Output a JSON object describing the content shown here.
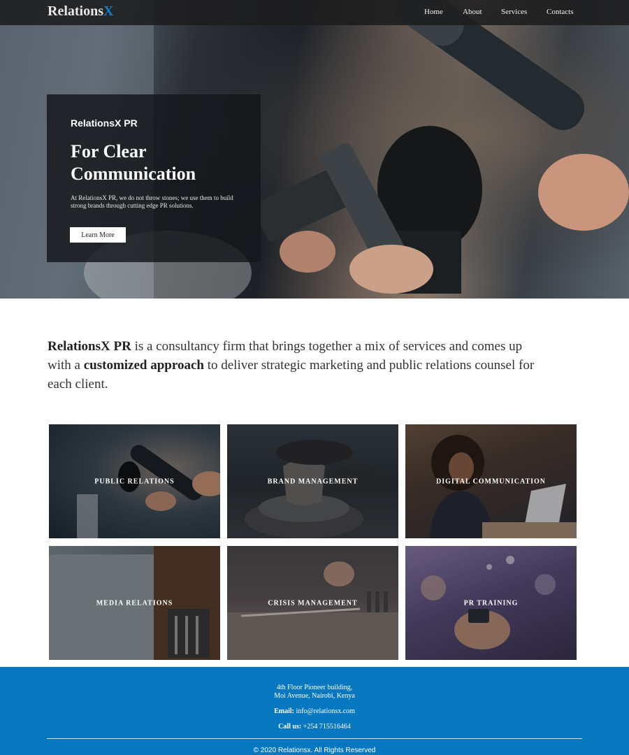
{
  "nav": {
    "logo_main": "Relations",
    "logo_accent": "X",
    "links": [
      "Home",
      "About",
      "Services",
      "Contacts"
    ]
  },
  "hero": {
    "kicker": "RelationsX PR",
    "title": "For Clear Communication",
    "description": "At RelationsX PR, we do not throw stones; we use them to build strong brands through cutting edge PR solutions.",
    "button_label": "Learn More"
  },
  "intro": {
    "brand": "RelationsX PR",
    "text_1": " is a consultancy firm that brings together a mix of services and comes up with a ",
    "emphasis": "customized approach",
    "text_2": " to deliver strategic marketing and public relations counsel for each client."
  },
  "services": [
    {
      "label": "PUBLIC RELATIONS"
    },
    {
      "label": "BRAND MANAGEMENT"
    },
    {
      "label": "DIGITAL COMMUNICATION"
    },
    {
      "label": "MEDIA RELATIONS"
    },
    {
      "label": "CRISIS MANAGEMENT"
    },
    {
      "label": "PR TRAINING"
    }
  ],
  "footer": {
    "address_line_1": "4th Floor Pioneer building,",
    "address_line_2": "Moi Avenue, Nairobi, Kenya",
    "email_label": "Email:",
    "email_value": "info@relationsx.com",
    "phone_label": "Call us:",
    "phone_value": "+254 715516464",
    "copyright": "© 2020 Relationsx. All Rights Reserved"
  },
  "colors": {
    "brand_accent": "#1b7bc2",
    "footer_bg": "#0778c0",
    "nav_bg": "#1c1c1e"
  }
}
